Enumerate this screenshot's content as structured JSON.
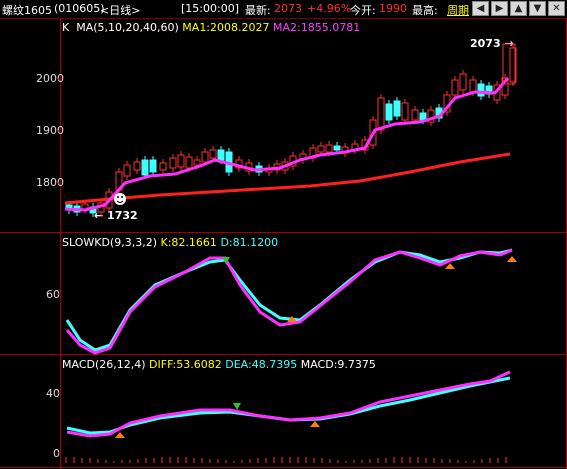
{
  "header": {
    "symbol": "螺纹1605",
    "code": "(010605)",
    "period_tag": "<日线>",
    "time": "[15:00:00]",
    "latest_label": "最新:",
    "latest_value": "2073",
    "change": "+4.96%",
    "open_label": "今开:",
    "open_value": "1990",
    "high_label": "最高:",
    "period_btn": "周期",
    "colors": {
      "up": "#ff3030",
      "label": "#ffffff",
      "accent": "#ffff00"
    }
  },
  "nav_buttons": [
    "left-icon",
    "right-icon",
    "up-icon",
    "down-icon",
    "close-icon"
  ],
  "price_panel": {
    "title_k": "K",
    "title_ma": "MA(5,10,20,40,60)",
    "ma1": "MA1:2008.2027",
    "ma2": "MA2:1855.0781",
    "y_labels": [
      "2000",
      "1900",
      "1800"
    ],
    "high_note": "2073",
    "low_note": "1732"
  },
  "kd_panel": {
    "title": "SLOWKD(9,3,3,2)",
    "k": "K:82.1661",
    "d": "D:81.1200",
    "y_labels": [
      "60"
    ]
  },
  "macd_panel": {
    "title": "MACD(26,12,4)",
    "diff": "DIFF:53.6082",
    "dea": "DEA:48.7395",
    "macd": "MACD:9.7375",
    "y_labels": [
      "40",
      "0"
    ]
  }
}
